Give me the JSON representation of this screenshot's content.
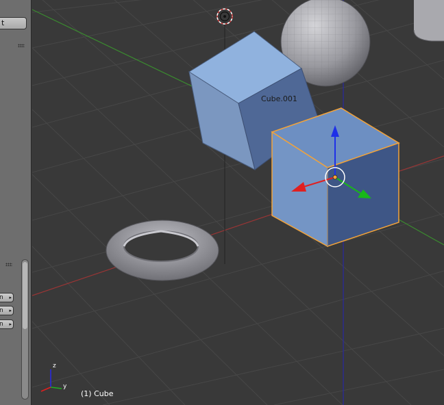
{
  "viewport": {
    "object_label": "Cube.001",
    "active_object": "(1) Cube",
    "axis_gizmo": {
      "z": "z",
      "y": "y"
    }
  },
  "left_panel": {
    "top_button_label": "t",
    "tool_rows": [
      {
        "label": "n",
        "arrow": "▸"
      },
      {
        "label": "n",
        "arrow": "▸"
      },
      {
        "label": "n",
        "arrow": "▸"
      }
    ]
  },
  "colors": {
    "background": "#393939",
    "grid": "#474747",
    "x_axis": "#9a3535",
    "y_axis": "#3a8a2f",
    "z_axis": "#2a2a9a",
    "mesh": "#7f9ec8",
    "selection_outline": "#f2a33a"
  },
  "icons": [
    "3d-cursor-icon",
    "manipulator-z-arrow-icon",
    "manipulator-x-arrow-icon",
    "manipulator-y-arrow-icon",
    "axis-orientation-icon"
  ]
}
